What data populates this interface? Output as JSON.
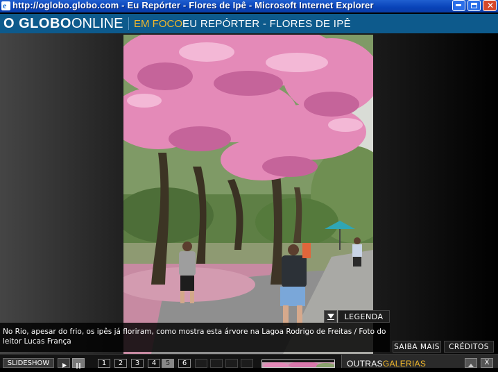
{
  "window": {
    "title": "http://oglobo.globo.com - Eu Repórter - Flores de Ipê - Microsoft Internet Explorer",
    "close_glyph": "✕"
  },
  "header": {
    "logo_main": "O GLOBO",
    "logo_online": "ONLINE",
    "section_label": "EM FOCO:",
    "section_title": "EU REPÓRTER - FLORES DE IPÊ",
    "colors": {
      "bar": "#0d5a8c",
      "accent": "#f2b82b"
    }
  },
  "photo": {
    "subject": "pink ipê trees in bloom in a park, people walking on a path"
  },
  "caption": {
    "text": "No Rio, apesar do frio, os ipês já floriram, como mostra esta árvore na Lagoa Rodrigo de Freitas / Foto do leitor Lucas França"
  },
  "buttons": {
    "legend": "LEGENDA",
    "saiba_mais": "SAIBA MAIS",
    "creditos": "CRÉDITOS",
    "slideshow": "SLIDESHOW"
  },
  "pagination": {
    "pages": [
      "1",
      "2",
      "3",
      "4",
      "5",
      "6"
    ],
    "active_page": "5",
    "empty_slots": 4
  },
  "outras": {
    "label_a": "OUTRAS",
    "label_b": "GALERIAS",
    "close_glyph": "X"
  },
  "icons": [
    "ie-icon",
    "minimize-icon",
    "maximize-icon",
    "close-icon",
    "chevron-down-icon",
    "play-icon",
    "pause-icon",
    "scroll-up-icon"
  ]
}
